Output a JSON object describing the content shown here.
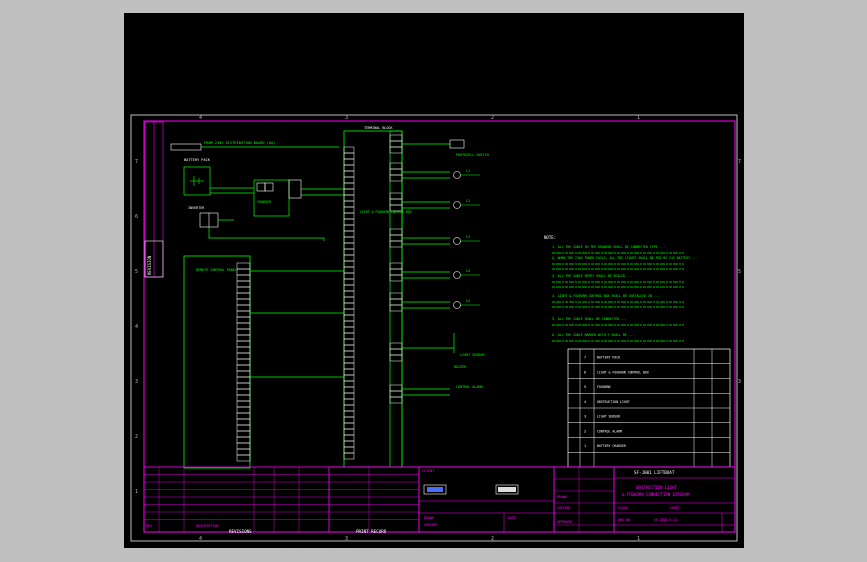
{
  "zone_numbers": {
    "top": [
      "4",
      "3",
      "2",
      "1"
    ],
    "side": [
      "7",
      "6",
      "5",
      "4",
      "3",
      "2",
      "1"
    ]
  },
  "revision_side_tag": "REVISION",
  "top_labels": {
    "obstruction_light": "OBSTRUCTION LIGHT",
    "cable_note": "FROM 230V DISTRIBUTION BOARD (6A)",
    "battery_pack": "BATTERY PACK",
    "charger_tag": "CHARGER",
    "inverter": "INVERTER",
    "photocell": "PHOTOCELL SWITCH",
    "light_sensor": "LIGHT SENSOR",
    "control_unit": "LIGHT & FOGHORN\nCONTROL BOX",
    "foghorn": "FOGHORN",
    "signal_lamp": "SIGNAL LAMP",
    "buzzer": "BUZZER",
    "terminal_block": "TERMINAL\nBLOCK",
    "control_alarm": "CONTROL ALARM",
    "remote_panel": "REMOTE CONTROL PANEL"
  },
  "lamp_labels": [
    "L1",
    "L2",
    "L3",
    "L4",
    "L5"
  ],
  "notes": {
    "heading": "NOTE:",
    "items": [
      "1. ALL THE CABLE IN THE DRAWING SHALL BE CONNECTED TYPE ...",
      "2. WHEN THE 230V POWER FAILS, ALL THE LIGHTS SHALL BE FED BY 24V BATTERY ...",
      "3. ALL THE CABLE ENTRY SHALL BE SEALED ...",
      "4. LIGHT & FOGHORN CONTROL BOX SHALL BE INSTALLED IN ...",
      "5. ALL THE CABLE SHALL BE CONNECTED ...",
      "6. ALL THE CABLE MARKED WITH * SHALL BE ..."
    ]
  },
  "parts_rows": [
    {
      "no": "7",
      "desc": "BATTERY PACK"
    },
    {
      "no": "6",
      "desc": "LIGHT & FOGHORN CONTROL BOX"
    },
    {
      "no": "5",
      "desc": "FOGHORN"
    },
    {
      "no": "4",
      "desc": "OBSTRUCTION LIGHT"
    },
    {
      "no": "3",
      "desc": "LIGHT SENSOR"
    },
    {
      "no": "2",
      "desc": "CONTROL ALARM"
    },
    {
      "no": "1",
      "desc": "BATTERY CHARGER"
    }
  ],
  "title_block": {
    "project": "SF-J001 LIFTBOAT",
    "title_line1": "OBSTRUCTION LIGHT",
    "title_line2": "& FOGHORN CONNECTION DIAGRAM",
    "scale_label": "SCALE",
    "sheet_label": "SHEET",
    "drawn_label": "DRAWN",
    "checked_label": "CHECKED",
    "approved_label": "APPROVED",
    "date_label": "DATE",
    "drawing_no_label": "DWG NO.",
    "client_label": "CLIENT",
    "revisions_label": "REVISIONS",
    "print_record_label": "PRINT RECORD",
    "description_label": "DESCRIPTION",
    "rev_label": "REV",
    "drawing_no": "SF-J001-E-21"
  },
  "colors": {
    "background": "#000000",
    "frame": "#ff00ff",
    "wire": "#00ff00",
    "terminal": "#ffffff",
    "text_green": "#00ff00",
    "text_white": "#ffffff",
    "title_magenta": "#ff00ff",
    "grid": "#bbbbbb",
    "gray_outer": "#c0c0c0"
  }
}
